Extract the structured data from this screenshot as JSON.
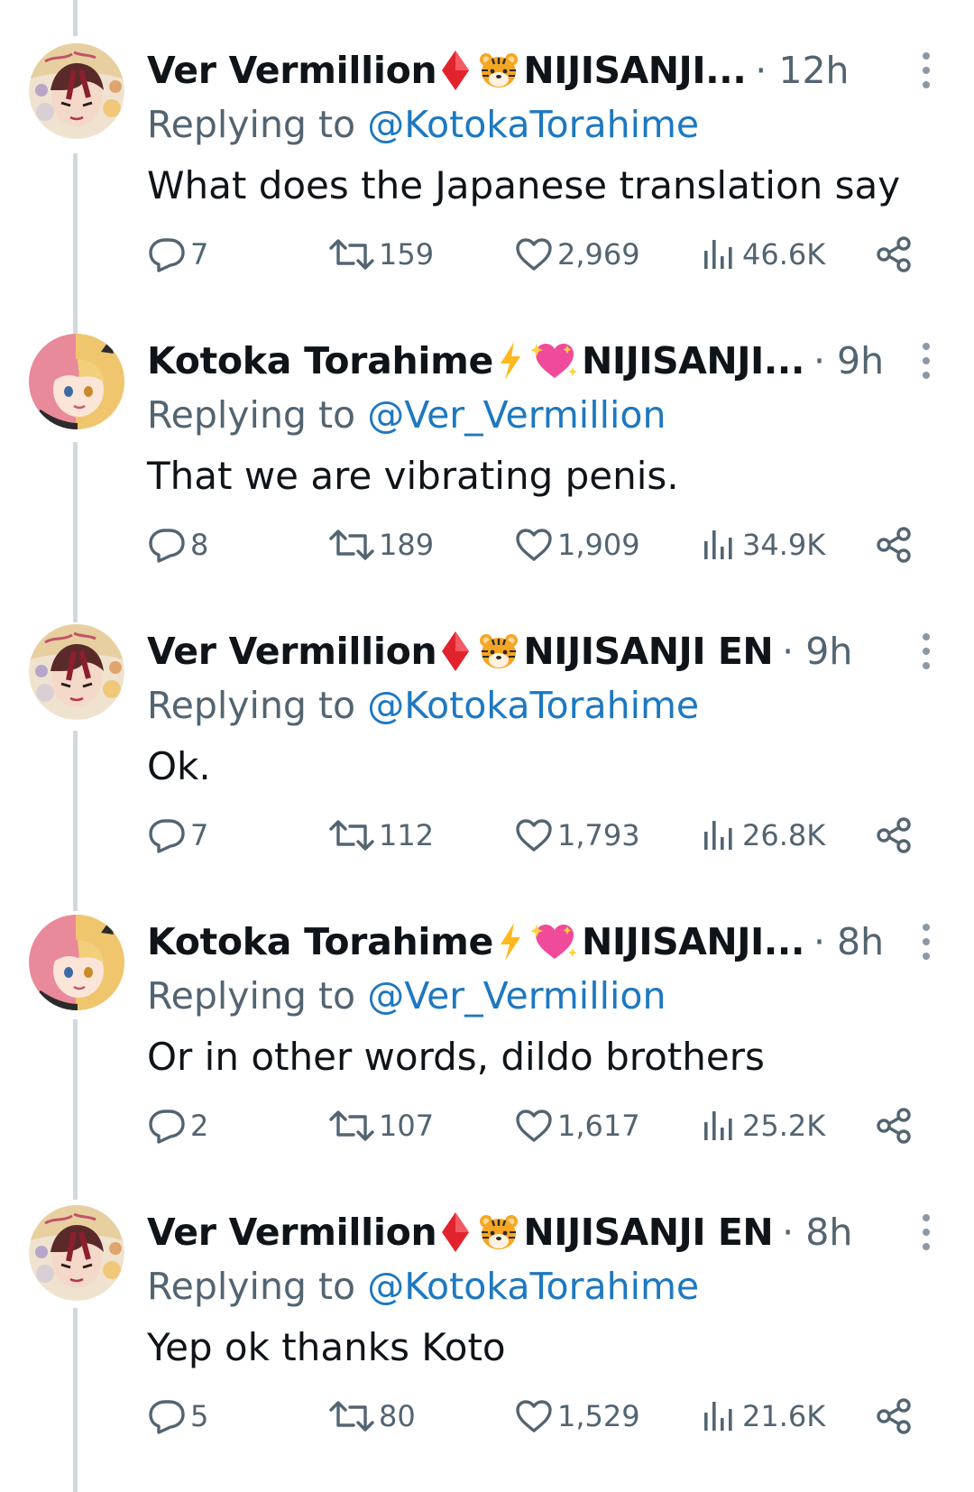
{
  "tweets": [
    {
      "author": "Ver Vermillion",
      "affiliation": "NIJISANJI...",
      "time": "12h",
      "reply_prefix": "Replying to",
      "reply_to": "@KotokaTorahime",
      "text": "What does the Japanese translation say",
      "replies": "7",
      "retweets": "159",
      "likes": "2,969",
      "views": "46.6K"
    },
    {
      "author": "Kotoka Torahime",
      "affiliation": "NIJISANJI...",
      "time": "9h",
      "reply_prefix": "Replying to",
      "reply_to": "@Ver_Vermillion",
      "text": "That we are vibrating penis.",
      "replies": "8",
      "retweets": "189",
      "likes": "1,909",
      "views": "34.9K"
    },
    {
      "author": "Ver Vermillion",
      "affiliation": "NIJISANJI EN",
      "time": "9h",
      "reply_prefix": "Replying to",
      "reply_to": "@KotokaTorahime",
      "text": "Ok.",
      "replies": "7",
      "retweets": "112",
      "likes": "1,793",
      "views": "26.8K"
    },
    {
      "author": "Kotoka Torahime",
      "affiliation": "NIJISANJI...",
      "time": "8h",
      "reply_prefix": "Replying to",
      "reply_to": "@Ver_Vermillion",
      "text": "Or in other words, dildo brothers",
      "replies": "2",
      "retweets": "107",
      "likes": "1,617",
      "views": "25.2K"
    },
    {
      "author": "Ver Vermillion",
      "affiliation": "NIJISANJI EN",
      "time": "8h",
      "reply_prefix": "Replying to",
      "reply_to": "@KotokaTorahime",
      "text": "Yep ok thanks Koto",
      "replies": "5",
      "retweets": "80",
      "likes": "1,529",
      "views": "21.6K"
    }
  ],
  "icons": {
    "reply": "reply-icon",
    "retweet": "retweet-icon",
    "like": "heart-icon",
    "views": "views-icon",
    "share": "share-icon",
    "more": "more-icon"
  },
  "colors": {
    "text": "#0f1419",
    "secondary": "#536471",
    "mention": "#1d78c1",
    "thread_line": "#cfd9de"
  }
}
